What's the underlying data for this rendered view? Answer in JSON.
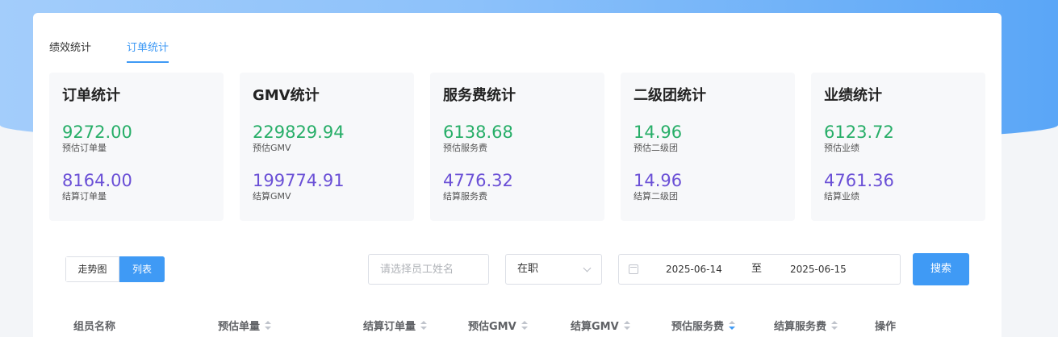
{
  "tabs": [
    {
      "label": "绩效统计",
      "active": false
    },
    {
      "label": "订单统计",
      "active": true
    }
  ],
  "stats": [
    {
      "title": "订单统计",
      "value1": "9272.00",
      "label1": "预估订单量",
      "value2": "8164.00",
      "label2": "结算订单量"
    },
    {
      "title": "GMV统计",
      "value1": "229829.94",
      "label1": "预估GMV",
      "value2": "199774.91",
      "label2": "结算GMV"
    },
    {
      "title": "服务费统计",
      "value1": "6138.68",
      "label1": "预估服务费",
      "value2": "4776.32",
      "label2": "结算服务费"
    },
    {
      "title": "二级团统计",
      "value1": "14.96",
      "label1": "预估二级团",
      "value2": "14.96",
      "label2": "结算二级团"
    },
    {
      "title": "业绩统计",
      "value1": "6123.72",
      "label1": "预估业绩",
      "value2": "4761.36",
      "label2": "结算业绩"
    }
  ],
  "view_toggle": {
    "trend_label": "走势图",
    "list_label": "列表",
    "active": "list"
  },
  "filters": {
    "employee_placeholder": "请选择员工姓名",
    "status_value": "在职",
    "date_start": "2025-06-14",
    "date_separator": "至",
    "date_end": "2025-06-15",
    "search_label": "搜索"
  },
  "table": {
    "columns": [
      {
        "label": "组员名称",
        "sortable": false
      },
      {
        "label": "预估单量",
        "sortable": true
      },
      {
        "label": "结算订单量",
        "sortable": true
      },
      {
        "label": "预估GMV",
        "sortable": true
      },
      {
        "label": "结算GMV",
        "sortable": true
      },
      {
        "label": "预估服务费",
        "sortable": true,
        "sort": "desc"
      },
      {
        "label": "结算服务费",
        "sortable": true
      },
      {
        "label": "操作",
        "sortable": false
      }
    ]
  },
  "colors": {
    "accent": "#3f9af5",
    "estimate": "#27ae68",
    "settled": "#6a4fd6"
  }
}
